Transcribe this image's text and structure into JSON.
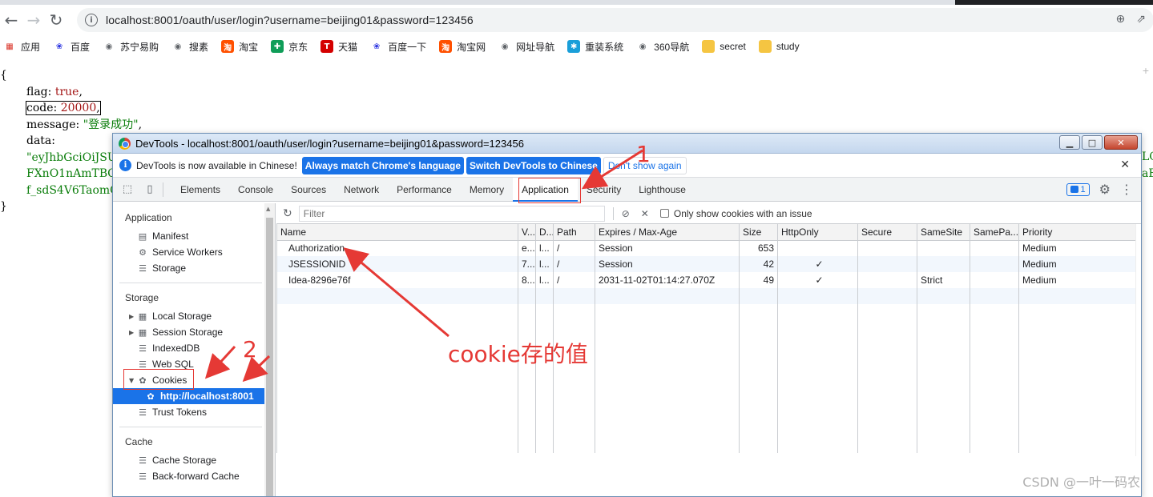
{
  "browser": {
    "url": "localhost:8001/oauth/user/login?username=beijing01&password=123456",
    "bookmarks": [
      {
        "label": "应用",
        "icon": "apps-grid-icon",
        "color": "#d93025"
      },
      {
        "label": "百度",
        "icon": "baidu-paw-icon",
        "color": "#2932e1"
      },
      {
        "label": "苏宁易购",
        "icon": "globe-icon",
        "color": "#5f6368"
      },
      {
        "label": "搜素",
        "icon": "globe-icon",
        "color": "#5f6368"
      },
      {
        "label": "淘宝",
        "icon": "taobao-icon",
        "color": "#ff5000"
      },
      {
        "label": "京东",
        "icon": "jd-icon",
        "color": "#0f9d58"
      },
      {
        "label": "天猫",
        "icon": "tmall-icon",
        "color": "#d40000"
      },
      {
        "label": "百度一下",
        "icon": "baidu-paw-icon",
        "color": "#2932e1"
      },
      {
        "label": "淘宝网",
        "icon": "taobao-icon",
        "color": "#ff5000"
      },
      {
        "label": "网址导航",
        "icon": "globe-icon",
        "color": "#5f6368"
      },
      {
        "label": "重装系统",
        "icon": "gear-badge-icon",
        "color": "#1a9fd9"
      },
      {
        "label": "360导航",
        "icon": "globe-icon",
        "color": "#5f6368"
      },
      {
        "label": "secret",
        "icon": "folder-icon",
        "color": "#f5c542"
      },
      {
        "label": "study",
        "icon": "folder-icon",
        "color": "#f5c542"
      }
    ]
  },
  "page": {
    "open_brace": "{",
    "flag_key": "flag: ",
    "flag_val": "true",
    "code_key": "code: ",
    "code_val": "20000",
    "message_key": "message: ",
    "message_val": "\"登录成功\"",
    "data_key": "data:",
    "token_line1": "\"eyJhbGciOiJSU",
    "token_line2": "FXnO1nAmTBQrVi",
    "token_line3": "f_sdS4V6TaomO",
    "token_right1": "LC",
    "token_right2": "aE",
    "close_brace": "}",
    "comma": ","
  },
  "devtools": {
    "window_title": "DevTools - localhost:8001/oauth/user/login?username=beijing01&password=123456",
    "infobar": {
      "message": "DevTools is now available in Chinese!",
      "btn_match": "Always match Chrome's language",
      "btn_switch": "Switch DevTools to Chinese",
      "btn_dont": "Don't show again"
    },
    "tabs": [
      "Elements",
      "Console",
      "Sources",
      "Network",
      "Performance",
      "Memory",
      "Application",
      "Security",
      "Lighthouse"
    ],
    "issues_count": "1",
    "sidebar": {
      "application_header": "Application",
      "application_items": [
        "Manifest",
        "Service Workers",
        "Storage"
      ],
      "storage_header": "Storage",
      "storage_items": [
        "Local Storage",
        "Session Storage",
        "IndexedDB",
        "Web SQL",
        "Cookies"
      ],
      "cookie_origin": "http://localhost:8001",
      "trust_tokens": "Trust Tokens",
      "cache_header": "Cache",
      "cache_items": [
        "Cache Storage",
        "Back-forward Cache"
      ]
    },
    "filter": {
      "placeholder": "Filter",
      "only_issue_label": "Only show cookies with an issue"
    },
    "table": {
      "columns": [
        "Name",
        "V...",
        "D...",
        "Path",
        "Expires / Max-Age",
        "Size",
        "HttpOnly",
        "Secure",
        "SameSite",
        "SamePa...",
        "Priority"
      ],
      "rows": [
        [
          "Authorization",
          "e...",
          "l...",
          "/",
          "Session",
          "653",
          "",
          "",
          "",
          "",
          "Medium"
        ],
        [
          "JSESSIONID",
          "7...",
          "l...",
          "/",
          "Session",
          "42",
          "✓",
          "",
          "",
          "",
          "Medium"
        ],
        [
          "Idea-8296e76f",
          "8...",
          "l...",
          "/",
          "2031-11-02T01:14:27.070Z",
          "49",
          "✓",
          "",
          "Strict",
          "",
          "Medium"
        ]
      ]
    }
  },
  "annotations": {
    "label1": "1",
    "label2": "2",
    "cookie_note": "cookie存的值",
    "color": "#e53935"
  },
  "watermark": "CSDN @一叶一码农"
}
